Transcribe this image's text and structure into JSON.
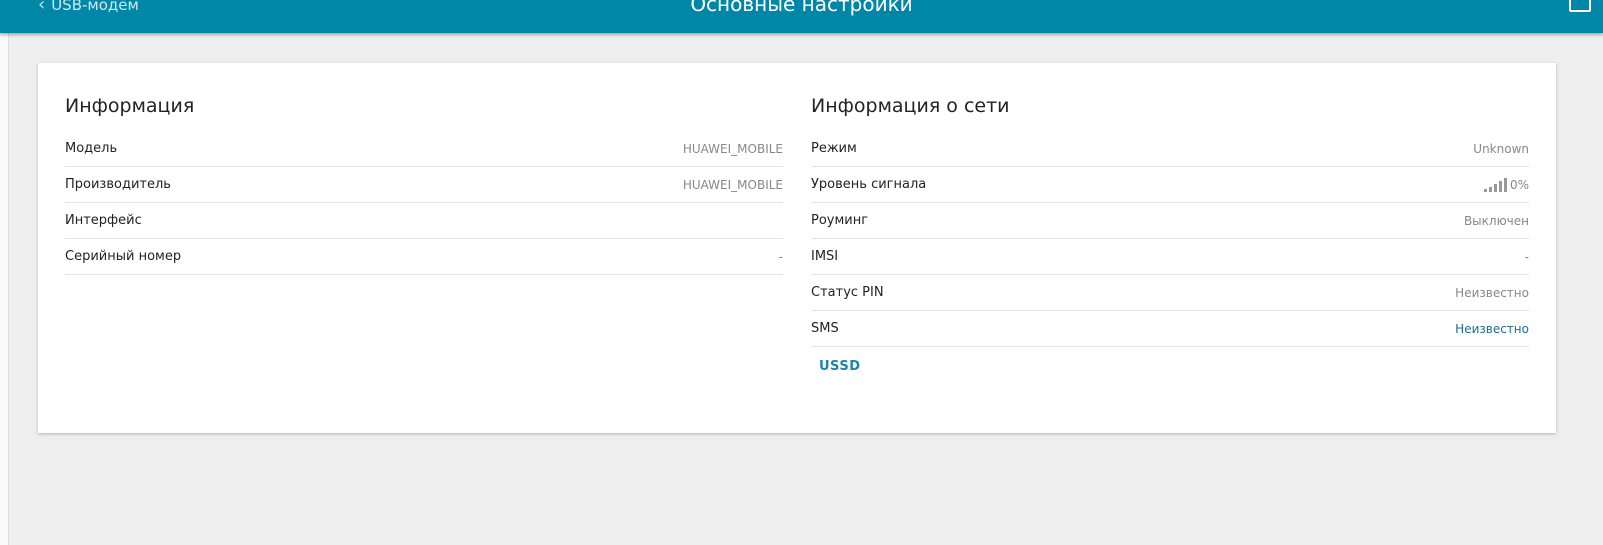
{
  "header": {
    "back_label": "USB-модем",
    "title": "Основные настройки"
  },
  "info": {
    "title": "Информация",
    "rows": [
      {
        "label": "Модель",
        "value": "HUAWEI_MOBILE"
      },
      {
        "label": "Производитель",
        "value": "HUAWEI_MOBILE"
      },
      {
        "label": "Интерфейс",
        "value": ""
      },
      {
        "label": "Серийный номер",
        "value": "-"
      }
    ]
  },
  "network": {
    "title": "Информация о сети",
    "rows": [
      {
        "label": "Режим",
        "value": "Unknown"
      },
      {
        "label": "Уровень сигнала",
        "value": "0%",
        "signal_percent": 0
      },
      {
        "label": "Роуминг",
        "value": "Выключен"
      },
      {
        "label": "IMSI",
        "value": "-"
      },
      {
        "label": "Статус PIN",
        "value": "Неизвестно"
      },
      {
        "label": "SMS",
        "value": "Неизвестно"
      }
    ],
    "ussd_label": "USSD"
  },
  "colors": {
    "header": "#0087a8",
    "link": "#1a6e92"
  }
}
